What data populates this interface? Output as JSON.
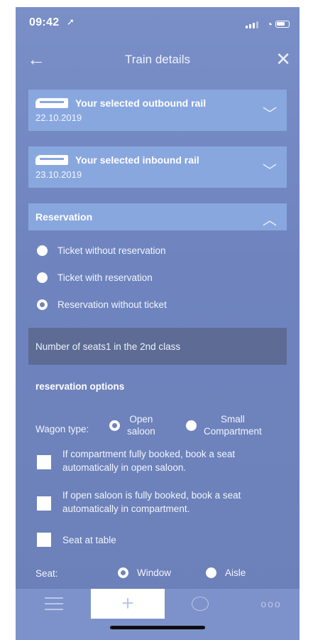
{
  "status_bar": {
    "time": "09:42",
    "location_icon": "location-arrow-icon"
  },
  "nav": {
    "title": "Train details",
    "back_icon": "arrow-left-icon",
    "close_icon": "close-icon"
  },
  "outbound": {
    "title": "Your selected outbound rail",
    "date": "22.10.2019",
    "icon": "train-icon"
  },
  "inbound": {
    "title": "Your selected inbound rail",
    "date": "23.10.2019",
    "icon": "train-icon"
  },
  "reservation": {
    "title": "Reservation",
    "options": [
      {
        "label": "Ticket without reservation",
        "selected": false
      },
      {
        "label": "Ticket with reservation",
        "selected": false
      },
      {
        "label": "Reservation without ticket",
        "selected": true
      }
    ],
    "seats_text": "Number of seats1  in the 2nd class"
  },
  "reservation_options": {
    "title": "reservation options",
    "wagon_type_label": "Wagon type:",
    "wagon_types": [
      {
        "line1": "Open",
        "line2": "saloon",
        "selected": true
      },
      {
        "line1": "Small",
        "line2": "Compartment",
        "selected": false
      }
    ],
    "checkboxes": [
      {
        "label": "If compartment fully booked, book a seat automatically in open saloon.",
        "checked": false
      },
      {
        "label": "If open saloon is fully booked, book a seat automatically in compartment.",
        "checked": false
      },
      {
        "label": "Seat at table",
        "checked": false
      }
    ],
    "seat_label": "Seat:",
    "seat_options": [
      {
        "label": "Window",
        "selected": true
      },
      {
        "label": "Aisle",
        "selected": false
      }
    ]
  },
  "tabbar": {
    "items": [
      "list-icon",
      "plus-icon",
      "chat-icon",
      "more-icon"
    ],
    "active": "plus-icon",
    "more_glyph": "ooo"
  }
}
